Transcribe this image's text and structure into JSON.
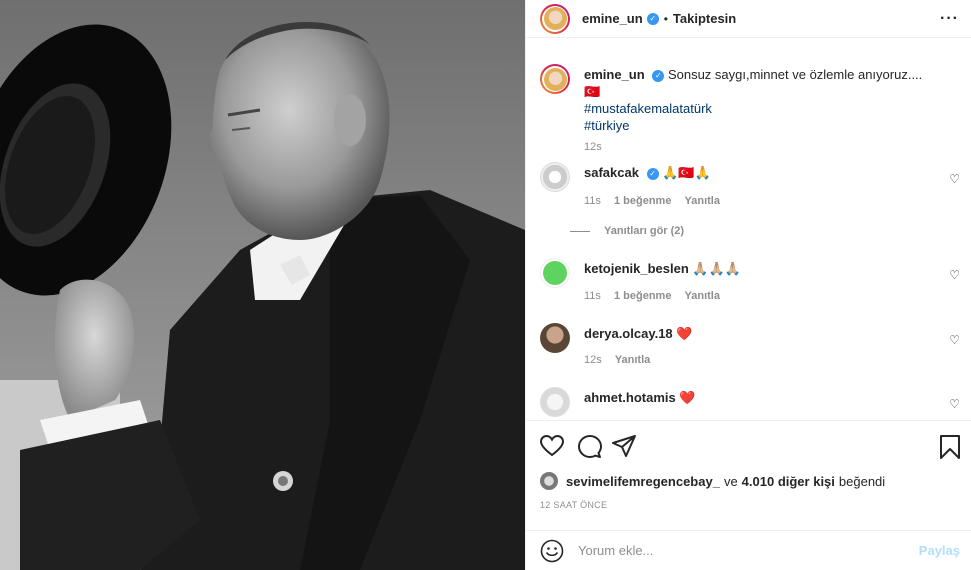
{
  "header": {
    "username": "emine_un",
    "separator": "•",
    "follow_status": "Takiptesin",
    "more_icon": "more-horizontal-icon"
  },
  "caption": {
    "username": "emine_un",
    "text": "Sonsuz saygı,minnet ve özlemle anıyoruz....🇹🇷",
    "hashtags": [
      "#mustafakemalatatürk",
      "#türkiye"
    ],
    "time": "12s"
  },
  "comments": [
    {
      "username": "safakcak",
      "verified": true,
      "text": "🙏🇹🇷🙏",
      "time": "11s",
      "likes": "1 beğenme",
      "reply": "Yanıtla",
      "view_replies": "Yanıtları gör (2)"
    },
    {
      "username": "ketojenik_beslen",
      "verified": false,
      "text": "🙏🏼🙏🏼🙏🏼",
      "time": "11s",
      "likes": "1 beğenme",
      "reply": "Yanıtla"
    },
    {
      "username": "derya.olcay.18",
      "verified": false,
      "text": "❤️",
      "time": "12s",
      "reply": "Yanıtla"
    },
    {
      "username": "ahmet.hotamis",
      "verified": false,
      "text": "❤️"
    }
  ],
  "likes_line": {
    "user": "sevimelifemregencebay_",
    "connector": "ve",
    "others": "4.010 diğer kişi",
    "suffix": "beğendi"
  },
  "time_ago": "12 SAAT ÖNCE",
  "add_comment": {
    "placeholder": "Yorum ekle...",
    "post_label": "Paylaş"
  },
  "colors": {
    "link": "#00376b",
    "verified": "#3897f0",
    "muted": "#8e8e8e",
    "heart": "#ed4956",
    "post_disabled": "#b2dffc"
  }
}
